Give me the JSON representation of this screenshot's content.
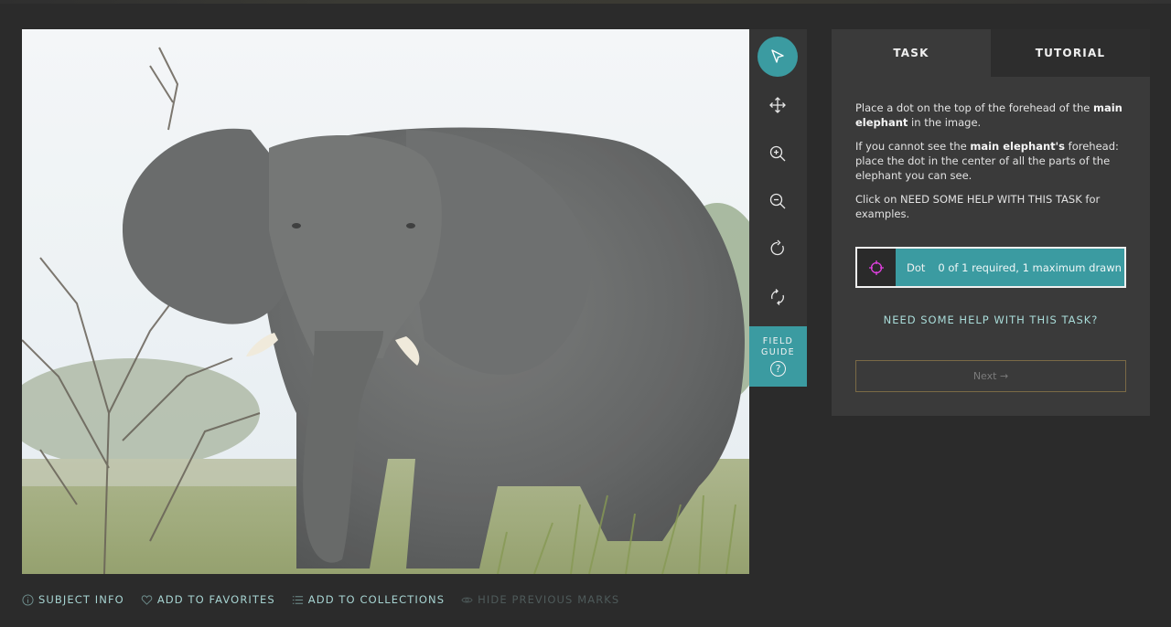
{
  "toolbar": {
    "tools": [
      {
        "icon": "pointer-arrow-icon",
        "active": true
      },
      {
        "icon": "move-arrows-icon",
        "active": false
      },
      {
        "icon": "zoom-in-icon",
        "active": false
      },
      {
        "icon": "zoom-out-icon",
        "active": false
      },
      {
        "icon": "rotate-icon",
        "active": false
      },
      {
        "icon": "reset-icon",
        "active": false
      }
    ],
    "field_guide_line1": "FIELD",
    "field_guide_line2": "GUIDE",
    "field_guide_symbol": "?"
  },
  "panel": {
    "tab_task": "TASK",
    "tab_tutorial": "TUTORIAL",
    "instruction1_pre": "Place a dot on the top of the forehead of the ",
    "instruction1_bold": "main elephant",
    "instruction1_post": " in the image.",
    "instruction2_pre": "If you cannot see the ",
    "instruction2_bold": "main elephant's",
    "instruction2_post": " forehead: place the dot in the center of all the parts of the elephant you can see.",
    "instruction3": "Click on NEED SOME HELP WITH THIS TASK for examples.",
    "dot_label": "Dot",
    "dot_count": "0 of 1 required, 1 maximum drawn",
    "help_link": "NEED SOME HELP WITH THIS TASK?",
    "next_button": "Next →"
  },
  "bottom": {
    "subject_info": "SUBJECT INFO",
    "add_favorites": "ADD TO FAVORITES",
    "add_collections": "ADD TO COLLECTIONS",
    "hide_marks": "HIDE PREVIOUS MARKS"
  },
  "colors": {
    "accent": "#3b9ba1",
    "background": "#2b2b2b",
    "panel": "#3a3a3a",
    "dot_icon": "#e040e0"
  }
}
